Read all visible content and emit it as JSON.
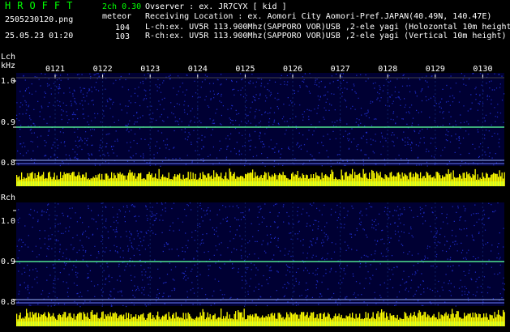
{
  "header": {
    "app_title": "HROFFT",
    "filename": "2505230120.png",
    "datetime": "25.05.23 01:20",
    "mode": "2ch 0.30",
    "type_label": "meteor",
    "count_l": "104",
    "count_r": "103"
  },
  "info": {
    "observer": "Ovserver                  : ex. JR7CYX [ kid ]",
    "location": "Receiving Location : ex. Aomori City Aomori-Pref.JAPAN(40.49N, 140.47E)",
    "lch": "L-ch:ex. UV5R 113.900Mhz(SAPPORO VOR)USB ,2-ele yagi (Holozontal 10m height)",
    "rch": "R-ch:ex. UV5R 113.900Mhz(SAPPORO VOR)USB ,2-ele yagi (Vertical 10m height)"
  },
  "axes": {
    "lch_label": "Lch",
    "khz_label": "kHz",
    "rch_label": "Rch",
    "lch_freq_ticks": [
      "1.0",
      "0.9",
      "0.8"
    ],
    "rch_freq_ticks": [
      "1.0",
      "0.9",
      "0.8"
    ],
    "time_ticks": [
      "0121",
      "0122",
      "0123",
      "0124",
      "0125",
      "0126",
      "0127",
      "0128",
      "0129",
      "0130"
    ]
  },
  "colors": {
    "title": "#00ff00",
    "mode": "#00ff00",
    "spectrogram_bg": "#000033",
    "noise": "#2a3cff",
    "carrier": "#5aff9a",
    "amplitude_bars": "#ffff00",
    "amplitude_base": "#00c8c8"
  }
}
